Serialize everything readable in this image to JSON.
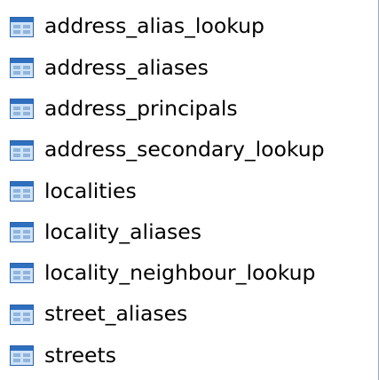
{
  "items": [
    {
      "label": "address_alias_lookup",
      "icon": "table-icon"
    },
    {
      "label": "address_aliases",
      "icon": "table-icon"
    },
    {
      "label": "address_principals",
      "icon": "table-icon"
    },
    {
      "label": "address_secondary_lookup",
      "icon": "table-icon"
    },
    {
      "label": "localities",
      "icon": "table-icon"
    },
    {
      "label": "locality_aliases",
      "icon": "table-icon"
    },
    {
      "label": "locality_neighbour_lookup",
      "icon": "table-icon"
    },
    {
      "label": "street_aliases",
      "icon": "table-icon"
    },
    {
      "label": "streets",
      "icon": "table-icon"
    }
  ],
  "colors": {
    "icon_header": "#2f6fbf",
    "icon_border": "#2b62aa",
    "icon_body": "#cfe3f8",
    "icon_cell": "#8fb4de"
  }
}
